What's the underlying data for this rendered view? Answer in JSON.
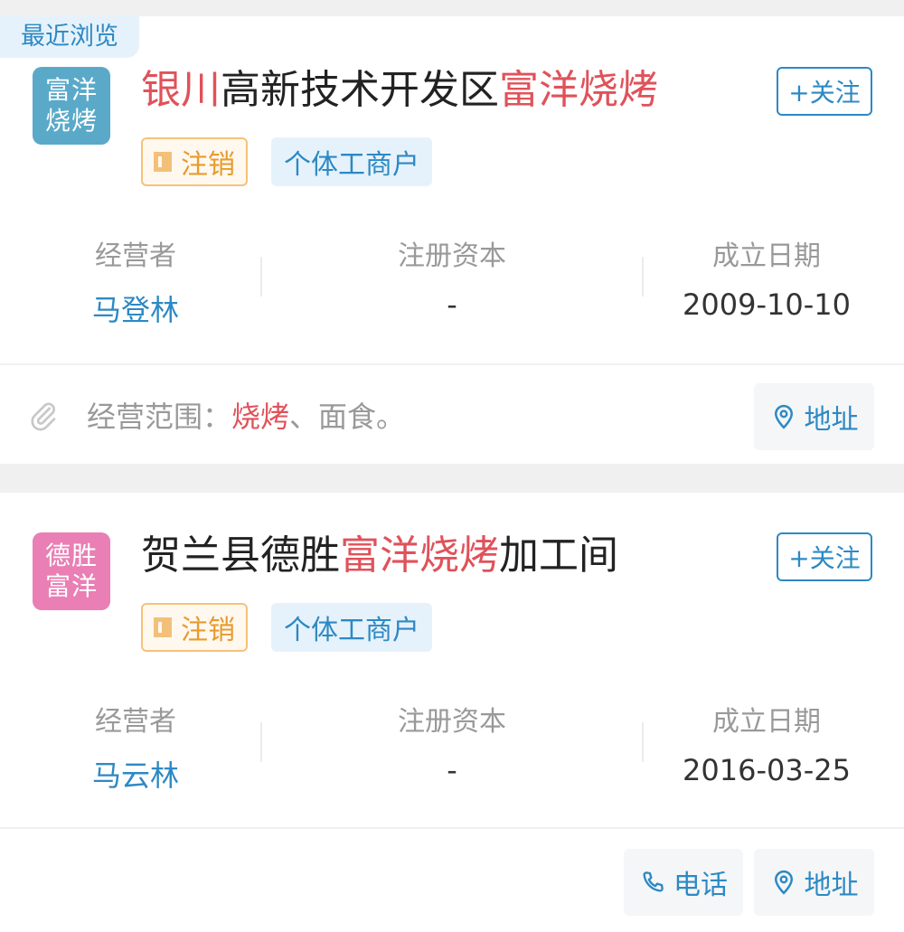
{
  "recent_label": "最近浏览",
  "cards": [
    {
      "logo": {
        "line1": "富洋",
        "line2": "烧烤",
        "color": "#5aa9c9"
      },
      "title": {
        "p1": "银川",
        "p2": "高新技术开发区",
        "p3": "富洋烧烤",
        "p4": ""
      },
      "follow_label": "+关注",
      "status_tag": "注销",
      "type_tag": "个体工商户",
      "info": {
        "operator_label": "经营者",
        "operator_value": "马登林",
        "capital_label": "注册资本",
        "capital_value": "-",
        "date_label": "成立日期",
        "date_value": "2009-10-10"
      },
      "scope": {
        "label": "经营范围：",
        "highlight": "烧烤",
        "rest": "、面食。"
      },
      "address_label": "地址"
    },
    {
      "logo": {
        "line1": "德胜",
        "line2": "富洋",
        "color": "#e97fb4"
      },
      "title": {
        "p1": "贺兰县德胜",
        "p2": "富洋烧烤",
        "p3": "加工间"
      },
      "follow_label": "+关注",
      "status_tag": "注销",
      "type_tag": "个体工商户",
      "info": {
        "operator_label": "经营者",
        "operator_value": "马云林",
        "capital_label": "注册资本",
        "capital_value": "-",
        "date_label": "成立日期",
        "date_value": "2016-03-25"
      },
      "phone_label": "电话",
      "address_label": "地址"
    }
  ],
  "colors": {
    "accent": "#2d89c4",
    "highlight": "#e0525a",
    "status": "#e89a2e"
  }
}
